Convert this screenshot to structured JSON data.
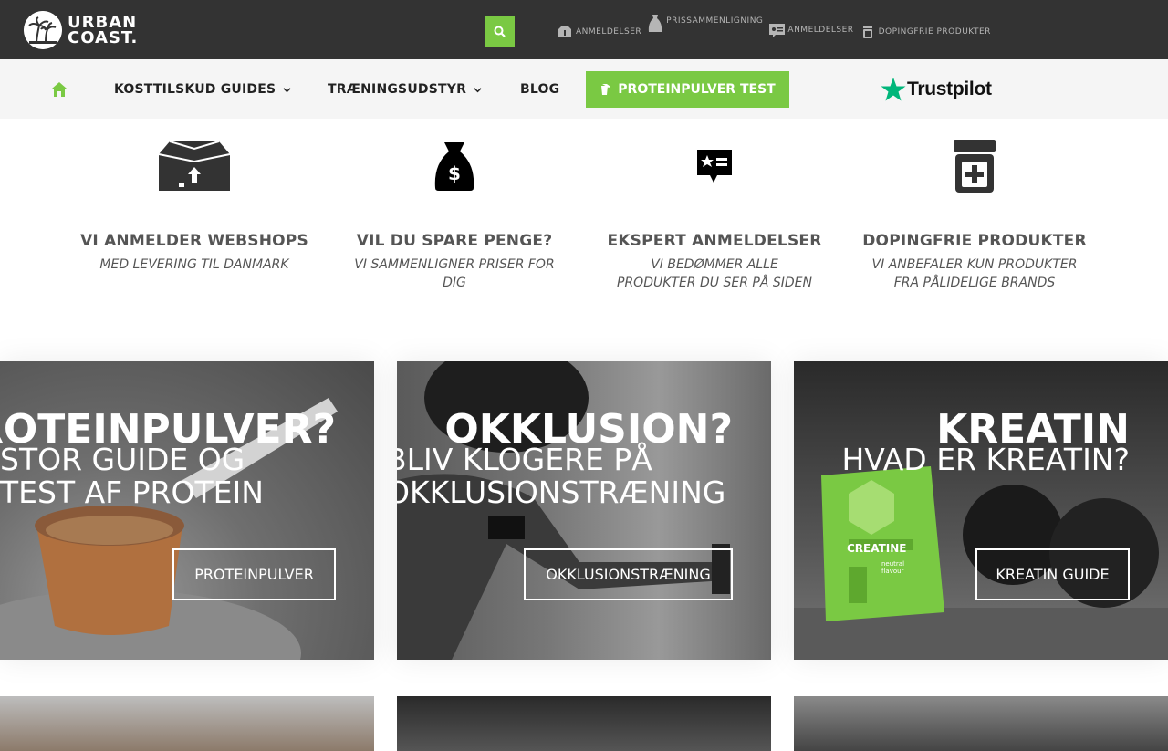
{
  "header": {
    "logo_alt": "URBAN COAST.",
    "logo_line1": "URBAN",
    "logo_line2": "COAST.",
    "top_links": [
      {
        "label": "ANMELDELSER",
        "icon": "box-icon"
      },
      {
        "label": "PRISSAMMENLIGNING",
        "icon": "money-bag-icon"
      },
      {
        "label": "ANMELDELSER",
        "icon": "review-card-icon"
      },
      {
        "label": "DOPINGFRIE PRODUKTER",
        "icon": "jar-icon"
      }
    ]
  },
  "nav": {
    "items": [
      {
        "label": "KOSTTILSKUD GUIDES",
        "has_dropdown": true
      },
      {
        "label": "TRÆNINGSUDSTYR",
        "has_dropdown": true
      },
      {
        "label": "BLOG",
        "has_dropdown": false
      }
    ],
    "cta_label": "PROTEINPULVER TEST",
    "trustpilot_label": "Trustpilot"
  },
  "features": [
    {
      "title": "VI ANMELDER WEBSHOPS",
      "subtitle": "MED LEVERING TIL DANMARK",
      "icon": "box-icon"
    },
    {
      "title": "VIL DU SPARE PENGE?",
      "subtitle": "VI SAMMENLIGNER PRISER FOR DIG",
      "icon": "money-bag-icon"
    },
    {
      "title": "EKSPERT ANMELDELSER",
      "subtitle": "VI BEDØMMER ALLE PRODUKTER DU SER PÅ SIDEN",
      "icon": "review-card-icon"
    },
    {
      "title": "DOPINGFRIE PRODUKTER",
      "subtitle": "VI ANBEFALER KUN PRODUKTER FRA PÅLIDELIGE BRANDS",
      "icon": "jar-icon"
    }
  ],
  "cards": [
    {
      "title": "ROTEINPULVER?",
      "subtitle": "STOR GUIDE OG TEST AF PROTEIN",
      "button": "PROTEINPULVER"
    },
    {
      "title": "OKKLUSION?",
      "subtitle": "BLIV KLOGERE PÅ OKKLUSIONSTRÆNING",
      "button": "OKKLUSIONSTRÆNING"
    },
    {
      "title": "KREATIN",
      "subtitle": "HVAD ER KREATIN?",
      "button": "KREATIN GUIDE",
      "product_label": "CREATINE",
      "product_sub": "neutral flavour"
    }
  ],
  "colors": {
    "accent": "#7ac943",
    "topbar": "#333333",
    "navbar": "#f5f5f5"
  }
}
